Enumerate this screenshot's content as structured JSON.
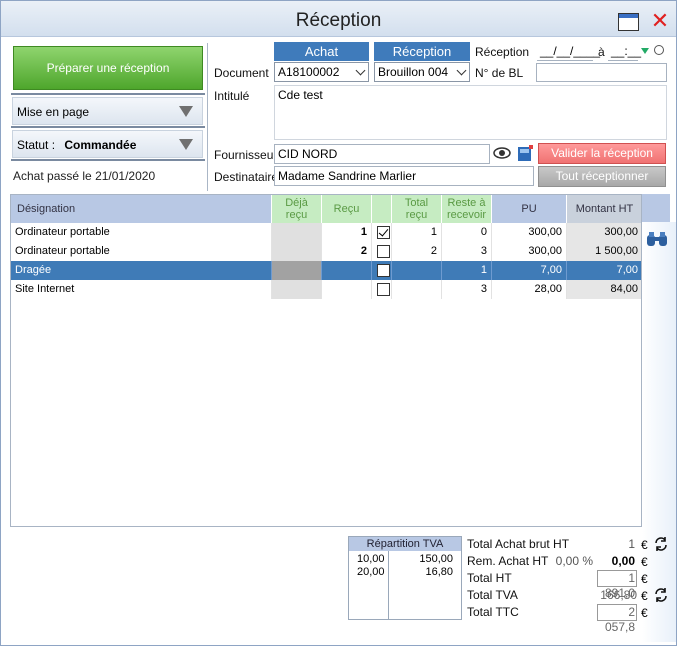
{
  "window": {
    "title": "Réception"
  },
  "left": {
    "prepare_button": "Préparer une réception",
    "mise_en_page": "Mise en page",
    "statut_label": "Statut :",
    "statut_value": "Commandée",
    "achat_passe": "Achat passé le",
    "achat_date": "21/01/2020"
  },
  "form": {
    "achat_header": "Achat",
    "reception_header": "Réception",
    "document_label": "Document",
    "achat_doc": "A18100002",
    "reception_doc": "Brouillon 004",
    "reception_label": "Réception",
    "reception_date": "__/__/____",
    "a_label": "à",
    "reception_time": "__:__",
    "bl_label": "N° de BL",
    "bl_value": "",
    "intitule_label": "Intitulé",
    "intitule_value": "Cde test",
    "fournisseur_label": "Fournisseur",
    "fournisseur_value": "CID NORD",
    "destinataire_label": "Destinataire",
    "destinataire_value": "Madame Sandrine Marlier",
    "valider_button": "Valider la réception",
    "tout_button": "Tout réceptionner"
  },
  "table": {
    "headers": {
      "designation": "Désignation",
      "deja_recu_1": "Déjà",
      "deja_recu_2": "reçu",
      "recu": "Reçu",
      "total_recu_1": "Total",
      "total_recu_2": "reçu",
      "reste_1": "Reste à",
      "reste_2": "recevoir",
      "pu": "PU",
      "montant": "Montant HT"
    },
    "rows": [
      {
        "designation": "Ordinateur portable",
        "recu": "1",
        "checked": true,
        "total_recu": "1",
        "reste": "0",
        "pu": "300,00",
        "montant": "300,00"
      },
      {
        "designation": "Ordinateur portable",
        "recu": "2",
        "checked": false,
        "total_recu": "2",
        "reste": "3",
        "pu": "300,00",
        "montant": "1 500,00"
      },
      {
        "designation": "Dragée",
        "recu": "",
        "checked": false,
        "total_recu": "",
        "reste": "1",
        "pu": "7,00",
        "montant": "7,00"
      },
      {
        "designation": "Site Internet",
        "recu": "",
        "checked": false,
        "total_recu": "",
        "reste": "3",
        "pu": "28,00",
        "montant": "84,00"
      }
    ]
  },
  "tva": {
    "title": "Répartition TVA",
    "rates": [
      "10,00",
      "20,00"
    ],
    "amounts": [
      "150,00",
      "16,80"
    ]
  },
  "totals": {
    "brut_label": "Total Achat brut HT",
    "brut_value": "1",
    "rem_label": "Rem. Achat HT",
    "rem_pct": "0,00 %",
    "rem_value": "0,00",
    "ht_label": "Total HT",
    "ht_value": "1 891,0",
    "tva_label": "Total TVA",
    "tva_value": "166,80",
    "ttc_label": "Total TTC",
    "ttc_value": "2 057,8",
    "currency": "€"
  }
}
